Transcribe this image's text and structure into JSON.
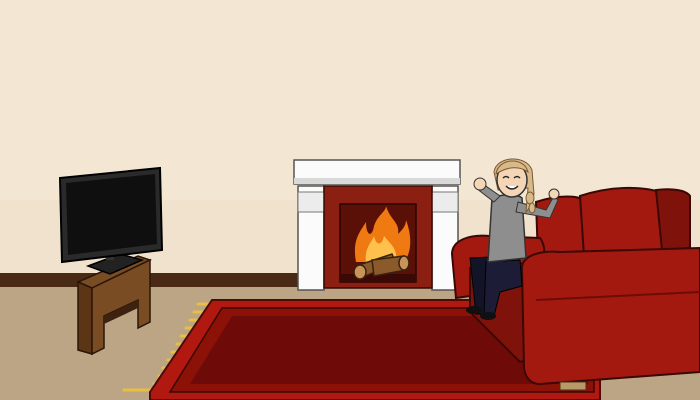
{
  "scene": {
    "description_free": true,
    "objects": [
      "wall",
      "baseboard",
      "floor",
      "rug",
      "tv-stand",
      "television",
      "fireplace",
      "fire",
      "logs",
      "sofa",
      "girl-character"
    ]
  },
  "colors": {
    "wall": "#f3e6d3",
    "wall_shade": "#efe0ca",
    "baseboard": "#4a2a14",
    "floor": "#bca585",
    "rug_fringe": "#e8c040",
    "rug_outer": "#b01810",
    "rug_border": "#8c1208",
    "rug_inner": "#6e0b08",
    "tv_screen": "#0f0f0f",
    "tv_frame": "#2a2a2a",
    "stand_top": "#7a4c24",
    "stand_side": "#5b3516",
    "mantel": "#fbfbfb",
    "mantel_shadow": "#d9d9d9",
    "firebox_brick": "#8a1f12",
    "firebox_inner": "#5a0f07",
    "fire_outer": "#f07a12",
    "fire_inner": "#ffc04d",
    "log": "#8a5a2a",
    "log_end": "#c9945a",
    "sofa": "#a3190f",
    "sofa_dark": "#7f120a",
    "girl_shirt": "#8e8e8e",
    "girl_pants": "#141428",
    "girl_skin": "#f4d6b6",
    "girl_hair": "#d8b98a"
  }
}
